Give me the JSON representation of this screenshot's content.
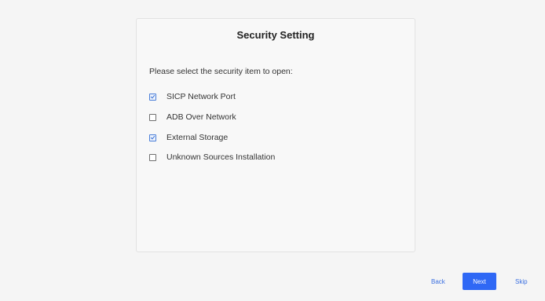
{
  "card": {
    "title": "Security Setting",
    "prompt": "Please select the security item to open:"
  },
  "options": [
    {
      "label": "SICP Network Port",
      "checked": true
    },
    {
      "label": "ADB Over Network",
      "checked": false
    },
    {
      "label": "External Storage",
      "checked": true
    },
    {
      "label": "Unknown Sources Installation",
      "checked": false
    }
  ],
  "footer": {
    "back_label": "Back",
    "next_label": "Next",
    "skip_label": "Skip"
  },
  "colors": {
    "accent": "#2f68f5",
    "link": "#3a6fe0"
  }
}
